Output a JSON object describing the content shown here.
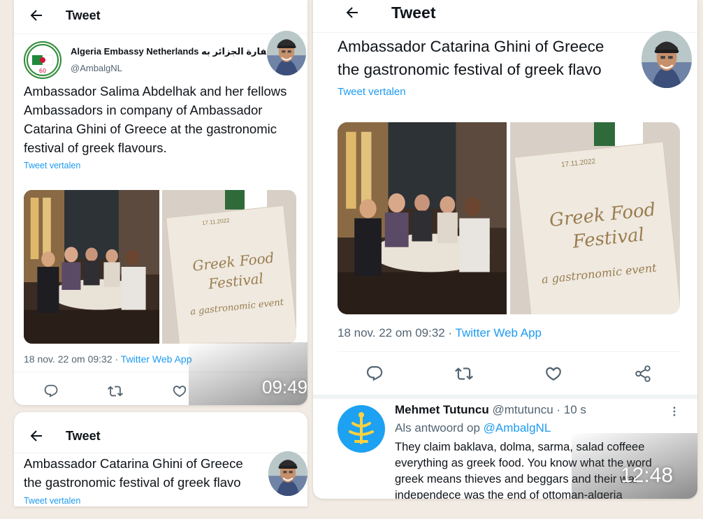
{
  "panel_a": {
    "header_title": "Tweet",
    "account_name": "Algeria Embassy Netherlands سفارة الجزائر به...",
    "account_handle": "@AmbalgNL",
    "tweet_text": "Ambassador Salima Abdelhak and her fellows Ambassadors in company of Ambassador Catarina Ghini  of Greece at the gastronomic festival of greek flavours.",
    "translate_label": "Tweet vertalen",
    "meta_date": "18 nov. 22 om 09:32 · ",
    "meta_source": "Twitter Web App",
    "clock": "09:49",
    "logo_text": "60"
  },
  "panel_b": {
    "header_title": "Tweet",
    "tweet_line1": "Ambassador Catarina Ghini  of Greece",
    "tweet_line2": "the gastronomic festival of greek flavo",
    "translate_label": "Tweet vertalen"
  },
  "panel_c": {
    "header_title": "Tweet",
    "tweet_line1": "Ambassador Catarina Ghini  of Greece",
    "tweet_line2": "the gastronomic festival of greek flavo",
    "translate_label": "Tweet vertalen",
    "meta_date": "18 nov. 22 om 09:32 · ",
    "meta_source": "Twitter Web App",
    "clock": "12:48",
    "reply": {
      "name": "Mehmet Tutuncu",
      "handle": "@mtutuncu · 10 s",
      "reply_to_prefix": "Als antwoord op ",
      "reply_to_handle": "@AmbalgNL",
      "line1": "They claim baklava, dolma, sarma, salad  coffeee",
      "line2": "everything as greek food. You know what the word",
      "line3": "greek means thieves and beggars  and their war",
      "line4": "independece was the end of ottoman-algeria"
    }
  },
  "menu_card": {
    "date": "17.11.2022",
    "title1": "Greek Food",
    "title2": "Festival",
    "subtitle": "a gastronomic event"
  },
  "colors": {
    "link": "#1d9bf0",
    "text": "#0f1419",
    "muted": "#536471",
    "avatar_blue": "#1da1f2"
  },
  "icons": [
    "back-arrow-icon",
    "reply-icon",
    "retweet-icon",
    "like-icon",
    "share-icon",
    "more-icon",
    "man-avatar",
    "embassy-logo"
  ]
}
